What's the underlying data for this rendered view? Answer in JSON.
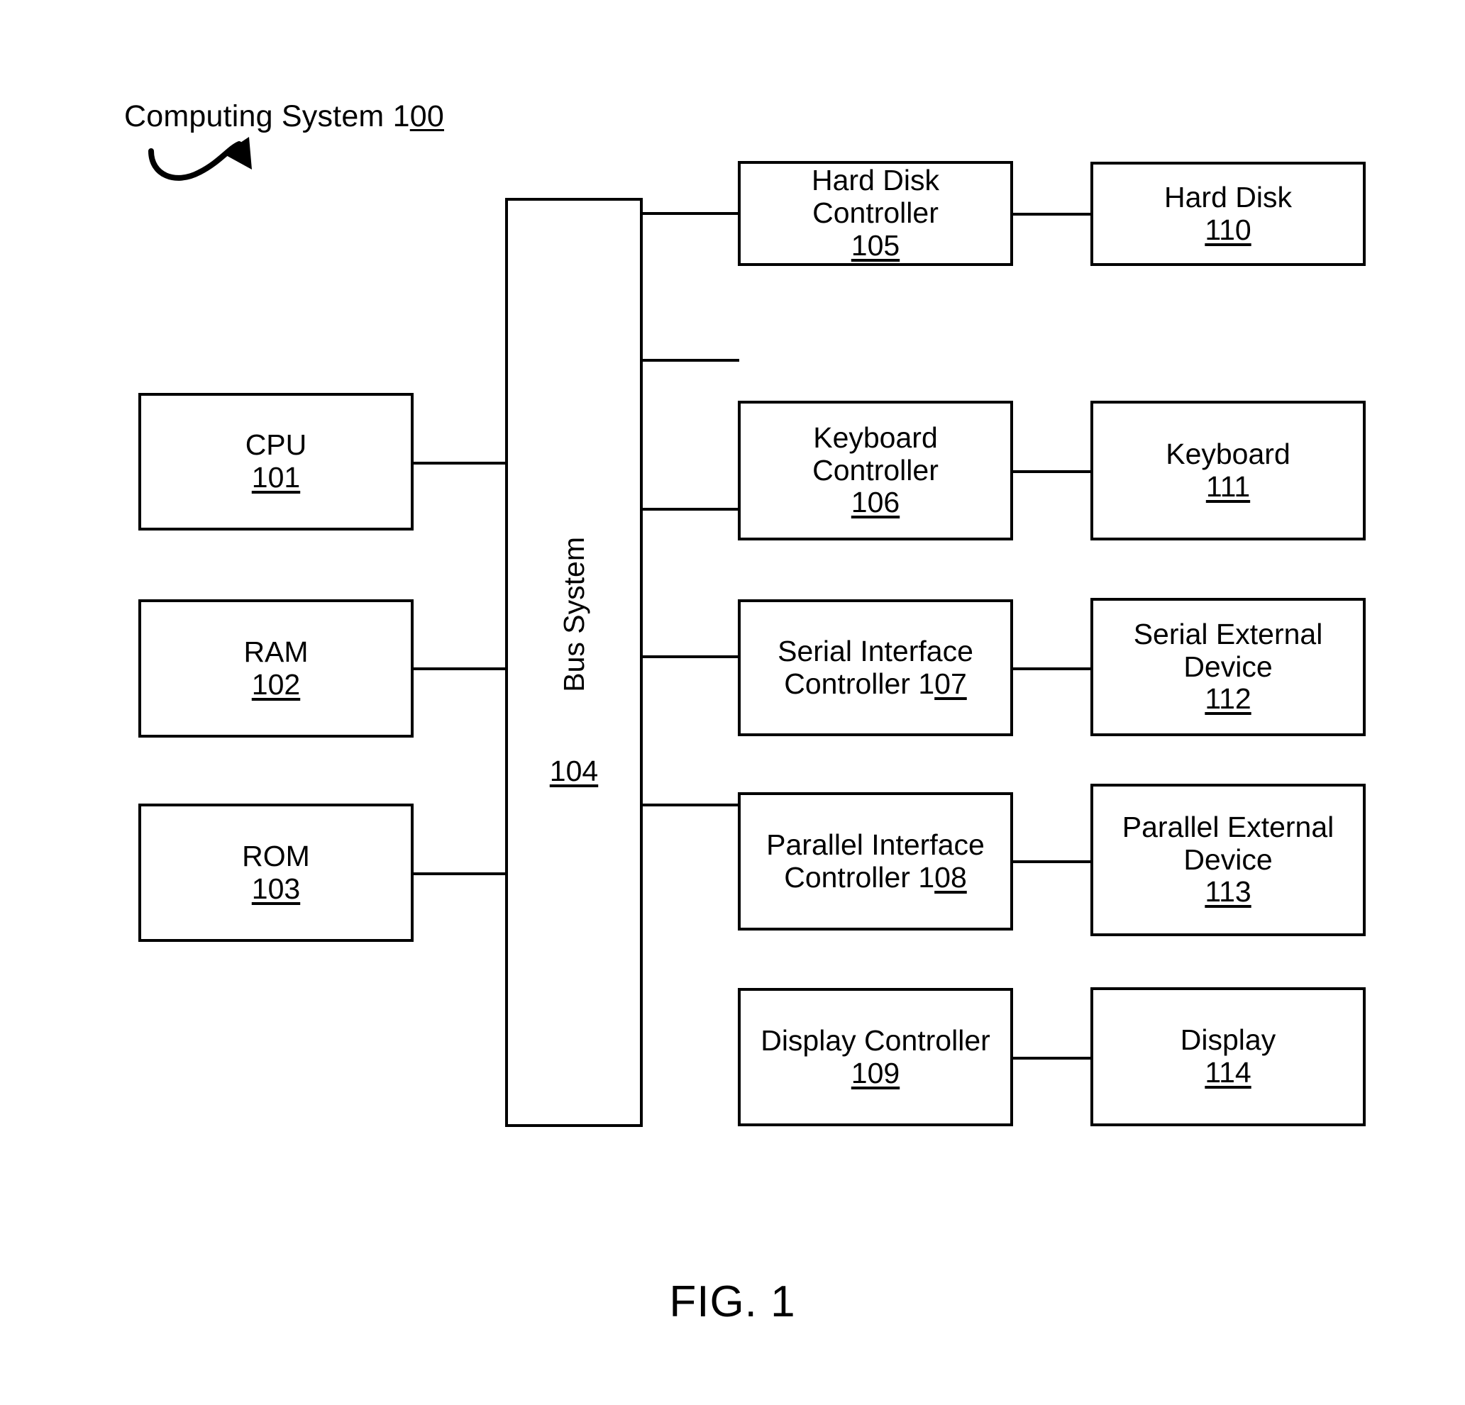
{
  "figure": {
    "title_prefix": "Computing System 1",
    "title_underlined": "00",
    "caption": "FIG. 1",
    "lead_arrow_icon": "curved-arrow-icon"
  },
  "bus": {
    "label": "Bus System",
    "number": "104"
  },
  "left_column": [
    {
      "label": "CPU",
      "number": "101"
    },
    {
      "label": "RAM",
      "number": "102"
    },
    {
      "label": "ROM",
      "number": "103"
    }
  ],
  "middle_column": [
    {
      "line1": "Hard Disk",
      "line2": "Controller",
      "number": "105",
      "number_prefix": ""
    },
    {
      "line1": "Keyboard",
      "line2": "Controller",
      "number": "106",
      "number_prefix": ""
    },
    {
      "line1": "Serial Interface",
      "line2": "Controller 1",
      "number": "07",
      "number_prefix": "inline"
    },
    {
      "line1": "Parallel Interface",
      "line2": "Controller 1",
      "number": "08",
      "number_prefix": "inline"
    },
    {
      "line1": "Display Controller",
      "line2": "",
      "number": "109",
      "number_prefix": ""
    }
  ],
  "right_column": [
    {
      "line1": "Hard Disk",
      "line2": "",
      "number": "110"
    },
    {
      "line1": "Keyboard",
      "line2": "",
      "number": "111"
    },
    {
      "line1": "Serial External",
      "line2": "Device",
      "number": "112"
    },
    {
      "line1": "Parallel External",
      "line2": "Device",
      "number": "113"
    },
    {
      "line1": "Display",
      "line2": "",
      "number": "114"
    }
  ],
  "colors": {
    "stroke": "#000000",
    "background": "#ffffff"
  }
}
